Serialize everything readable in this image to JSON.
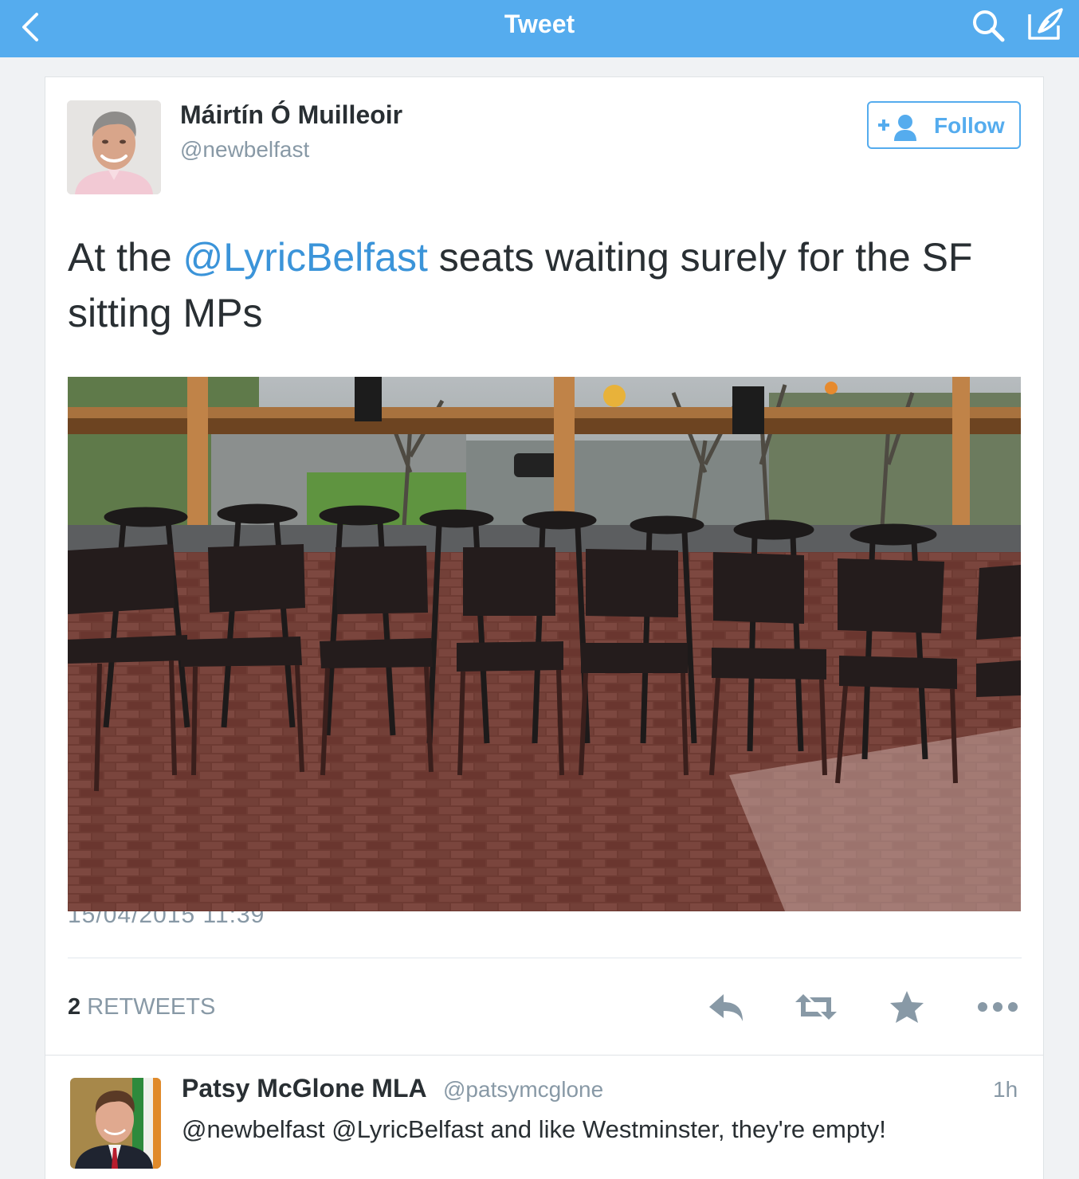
{
  "nav": {
    "title": "Tweet"
  },
  "tweet": {
    "author_name": "Máirtín Ó Muilleoir",
    "author_handle": "@newbelfast",
    "follow_label": "Follow",
    "text_prefix": "At the ",
    "mention": "@LyricBelfast",
    "text_suffix": " seats waiting surely for the SF sitting MPs",
    "photo_timestamp": "15/04/2015 11:39",
    "retweet_count": "2",
    "retweet_label": "RETWEETS"
  },
  "reply": {
    "name": "Patsy McGlone MLA",
    "handle": "@patsymcglone",
    "time": "1h",
    "text": "@newbelfast @LyricBelfast and like Westminster, they're empty!"
  },
  "icons": {
    "back": "chevron-left-icon",
    "search": "search-icon",
    "compose": "compose-icon",
    "follow": "add-user-icon",
    "reply": "reply-icon",
    "retweet": "retweet-icon",
    "favorite": "star-icon",
    "more": "more-icon"
  },
  "colors": {
    "navbar": "#55acee",
    "link": "#3b94d9",
    "muted": "#8899a6",
    "text": "#292f33"
  }
}
